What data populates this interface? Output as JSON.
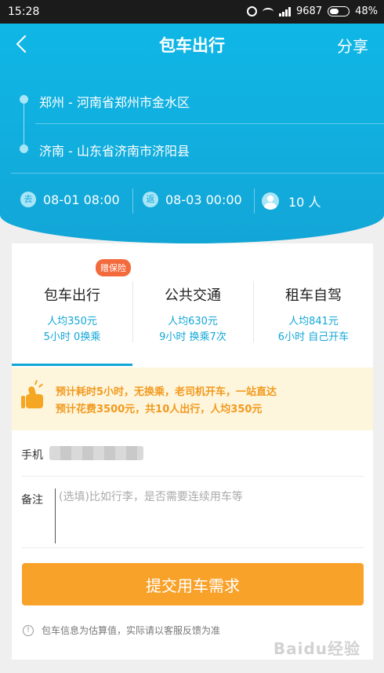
{
  "status_bar": {
    "time": "15:28",
    "network": "9687",
    "battery": "48%"
  },
  "header": {
    "title": "包车出行",
    "share": "分享"
  },
  "route": {
    "origin": "郑州 - 河南省郑州市金水区",
    "destination": "济南 - 山东省济南市济阳县"
  },
  "schedule": {
    "depart_icon": "去",
    "depart": "08-01 08:00",
    "return_icon": "返",
    "return": "08-03 00:00",
    "people": "10 人"
  },
  "tabs": [
    {
      "name": "包车出行",
      "price": "人均350元",
      "detail": "5小时 0换乘",
      "badge": "赠保险"
    },
    {
      "name": "公共交通",
      "price": "人均630元",
      "detail": "9小时 换乘7次"
    },
    {
      "name": "租车自驾",
      "price": "人均841元",
      "detail": "6小时 自己开车"
    }
  ],
  "tip": {
    "line1": "预计耗时5小时，无换乘，老司机开车，一站直达",
    "line2": "预计花费3500元，共10人出行，人均350元"
  },
  "form": {
    "phone_label": "手机",
    "note_label": "备注",
    "note_placeholder": "(选填)比如行李，是否需要连续用车等"
  },
  "submit_label": "提交用车需求",
  "footnote": {
    "icon": "!",
    "text": "包车信息为估算值，实际请以客服反馈为准"
  },
  "watermark": "Baidu经验",
  "colors": {
    "accent": "#12a6d7",
    "orange": "#f9a22a",
    "tip_bg": "#fdf5dc"
  }
}
